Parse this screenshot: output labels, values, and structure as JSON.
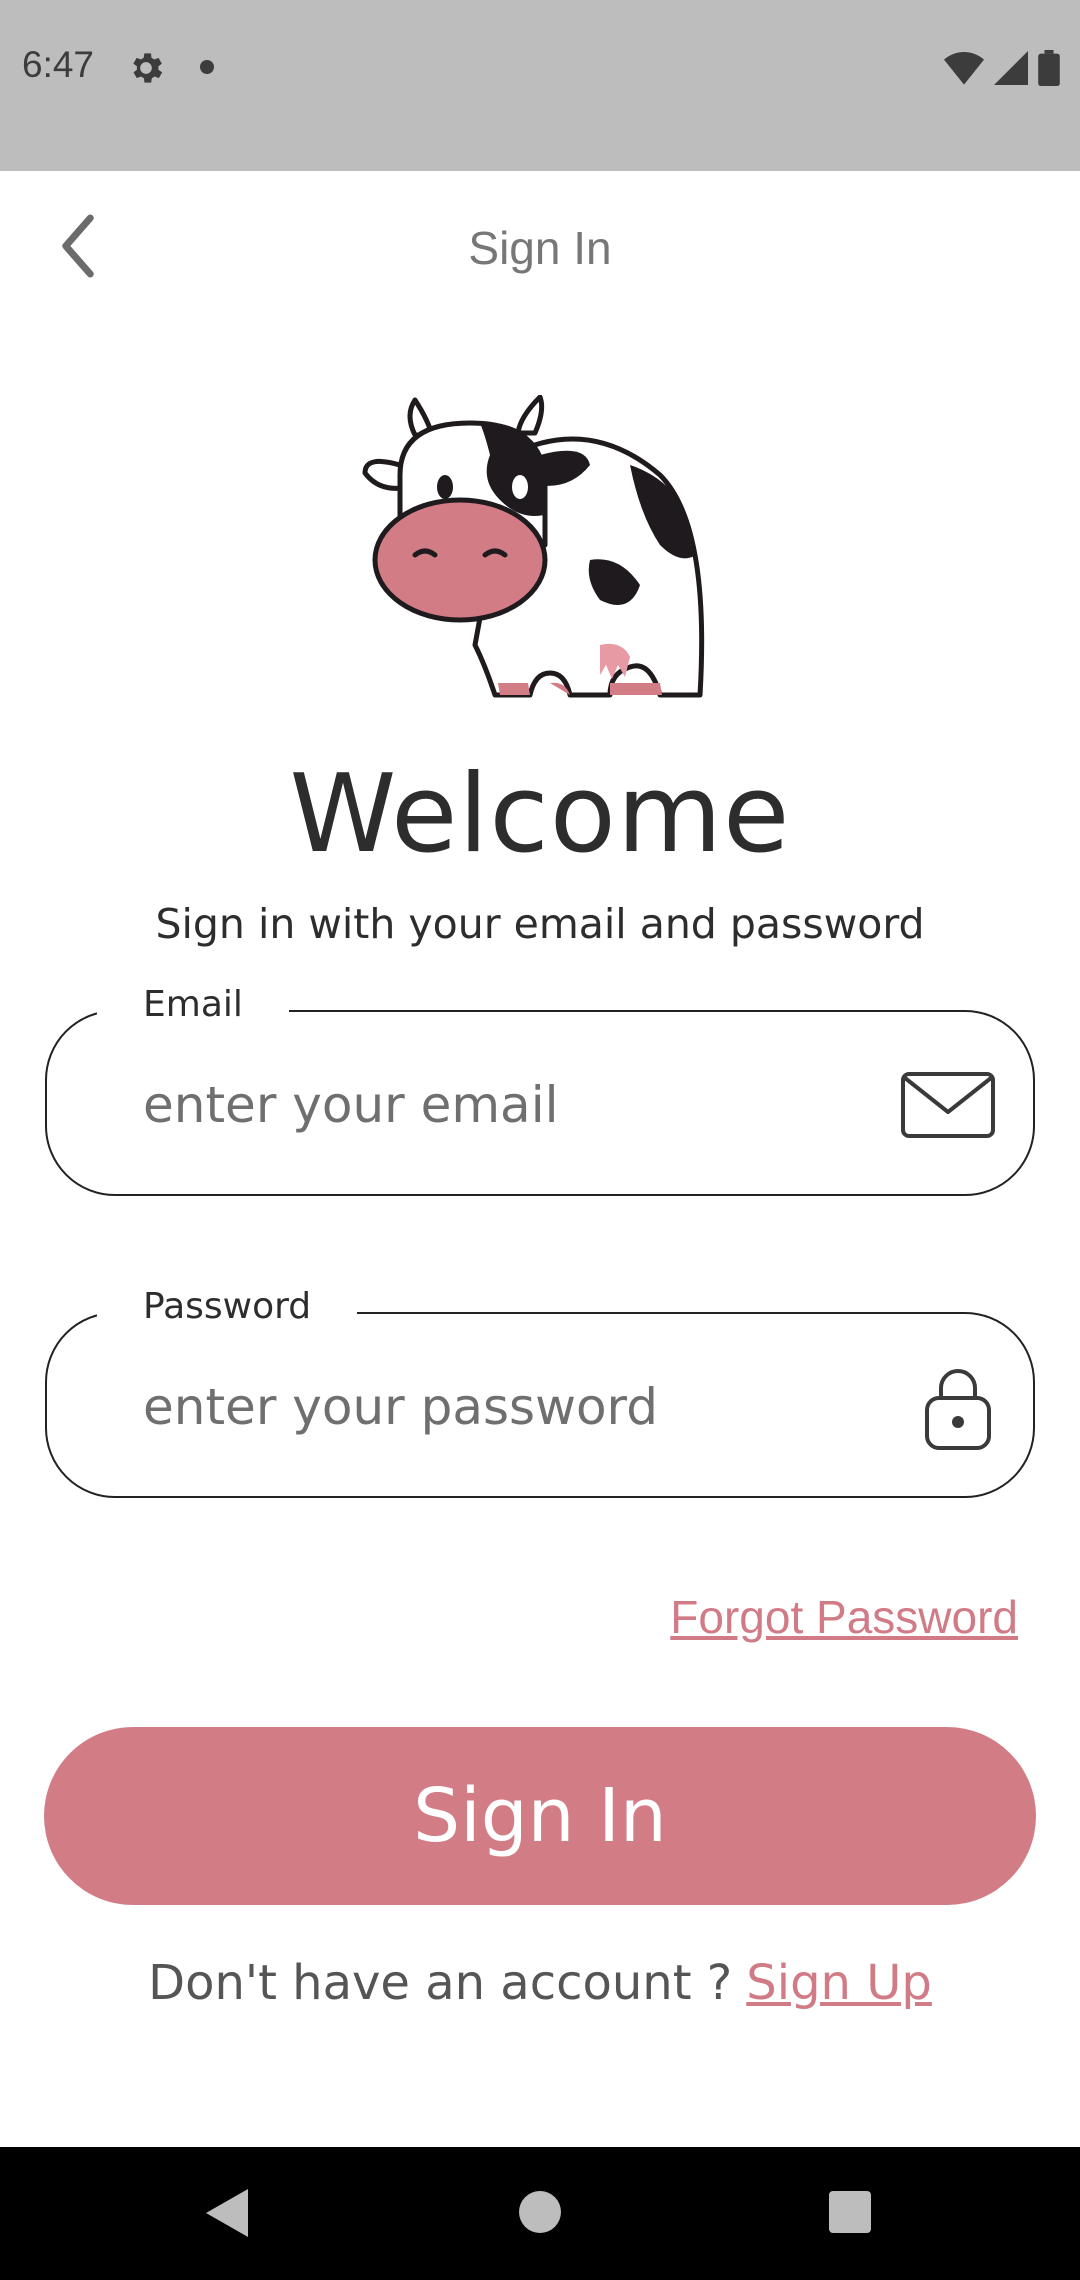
{
  "status_bar": {
    "time": "6:47",
    "icons": [
      "gear-icon",
      "dot-icon",
      "wifi-icon",
      "signal-icon",
      "battery-icon"
    ]
  },
  "app_bar": {
    "title": "Sign In",
    "back_icon": "chevron-left-icon"
  },
  "hero": {
    "image": "cow-mascot",
    "welcome": "Welcome",
    "subtitle": "Sign in with your email and password"
  },
  "form": {
    "email": {
      "label": "Email",
      "placeholder": "enter your email",
      "icon": "mail-icon"
    },
    "password": {
      "label": "Password",
      "placeholder": "enter your password",
      "icon": "lock-icon"
    },
    "forgot_password": "Forgot Password",
    "submit_label": "Sign In"
  },
  "footer": {
    "prompt": "Don't have an account ?",
    "signup_label": "Sign Up"
  },
  "colors": {
    "accent": "#d27d86",
    "status_bar": "#bdbdbd",
    "text": "#2d2d2d"
  },
  "nav_bar": {
    "icons": [
      "back-triangle-icon",
      "home-circle-icon",
      "recents-square-icon"
    ]
  }
}
